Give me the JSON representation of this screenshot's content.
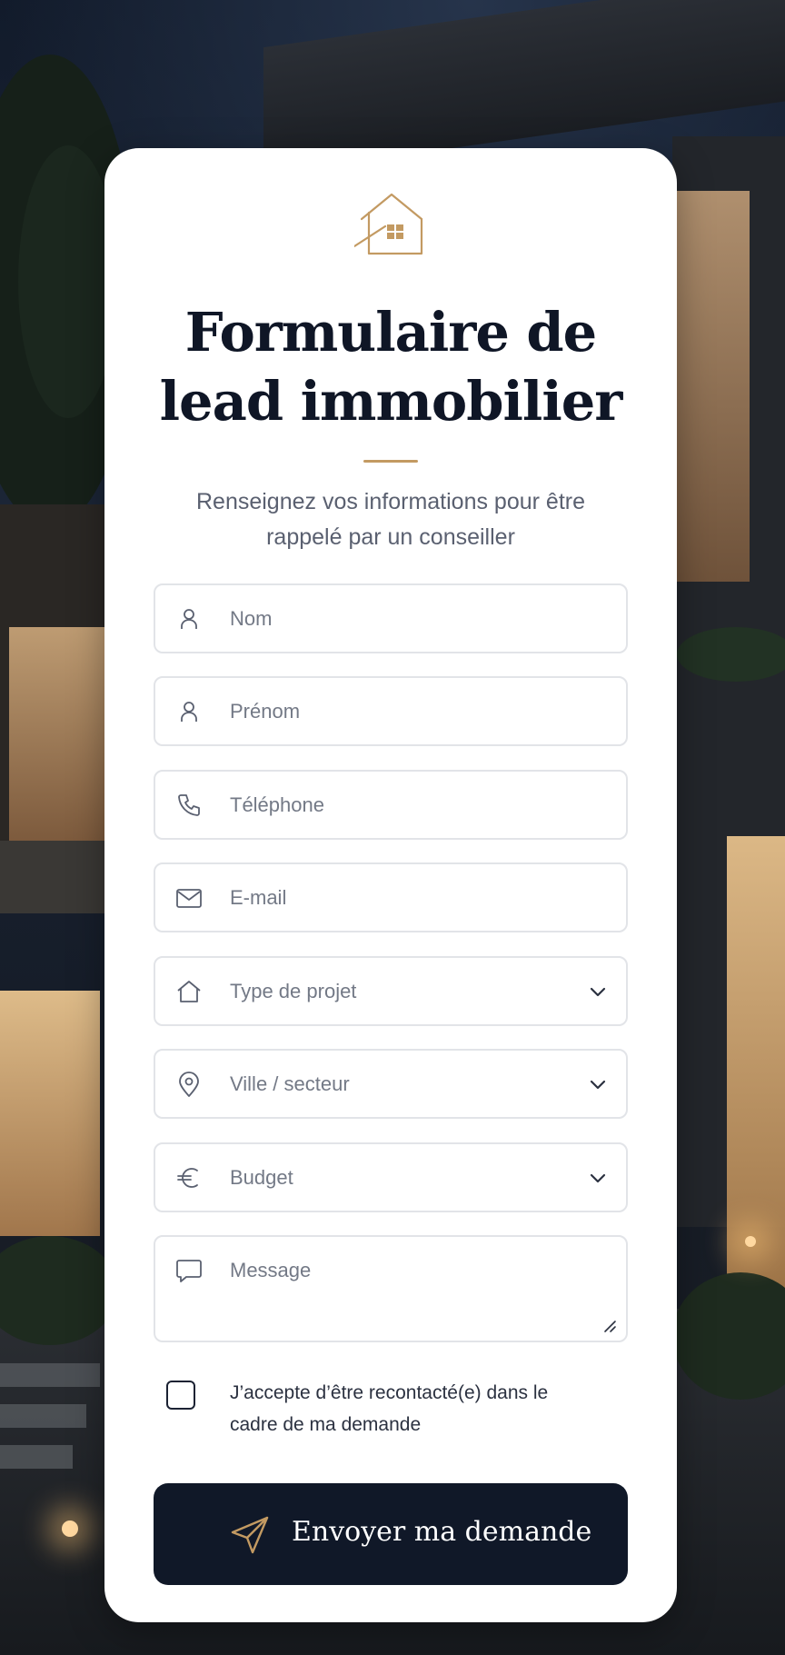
{
  "form": {
    "title_line1": "Formulaire de",
    "title_line2": "lead immobilier",
    "subtitle_line1": "Renseignez vos informations pour être",
    "subtitle_line2": "rappelé par un conseiller",
    "fields": [
      {
        "placeholder": "Nom",
        "icon": "user-icon"
      },
      {
        "placeholder": "Prénom",
        "icon": "user-icon"
      },
      {
        "placeholder": "Téléphone",
        "icon": "phone-icon"
      },
      {
        "placeholder": "E-mail",
        "icon": "mail-icon"
      },
      {
        "placeholder": "Type de projet",
        "icon": "home-icon",
        "dropdown": true
      },
      {
        "placeholder": "Ville / secteur",
        "icon": "location-pin-icon",
        "dropdown": true
      },
      {
        "placeholder": "Budget",
        "icon": "euro-icon",
        "dropdown": true
      },
      {
        "placeholder": "Message",
        "icon": "chat-bubble-icon",
        "multiline": true
      }
    ],
    "consent_line1": "J’accepte d’être recontacté(e) dans le",
    "consent_line2": "cadre de ma demande",
    "consent_checked": false,
    "submit_label": "Envoyer ma demande"
  },
  "colors": {
    "accent_gold": "#c39a62",
    "navy": "#101828",
    "card_bg": "#ffffff"
  }
}
